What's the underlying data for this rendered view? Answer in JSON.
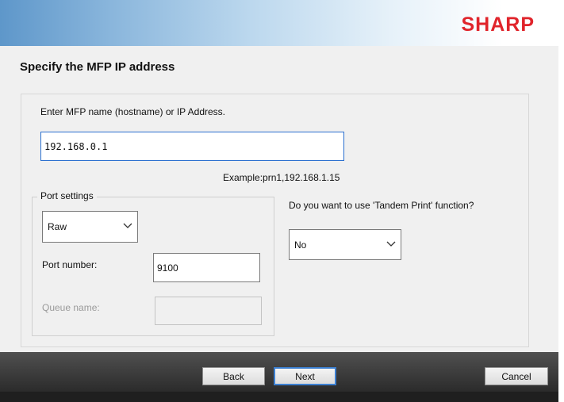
{
  "brand": {
    "logo_text": "SHARP",
    "logo_color": "#e0242b"
  },
  "page": {
    "title": "Specify the MFP IP address"
  },
  "address": {
    "label": "Enter MFP name (hostname) or IP Address.",
    "value": "192.168.0.1",
    "example": "Example:prn1,192.168.1.15"
  },
  "port_settings": {
    "group_label": "Port settings",
    "protocol_selected": "Raw",
    "port_number_label": "Port number:",
    "port_number_value": "9100",
    "queue_name_label": "Queue name:",
    "queue_name_value": ""
  },
  "tandem": {
    "question": "Do you want to use 'Tandem Print' function?",
    "selected": "No"
  },
  "buttons": {
    "back": "Back",
    "next": "Next",
    "cancel": "Cancel"
  },
  "icons": {
    "dropdown": "chevron-down-icon"
  }
}
